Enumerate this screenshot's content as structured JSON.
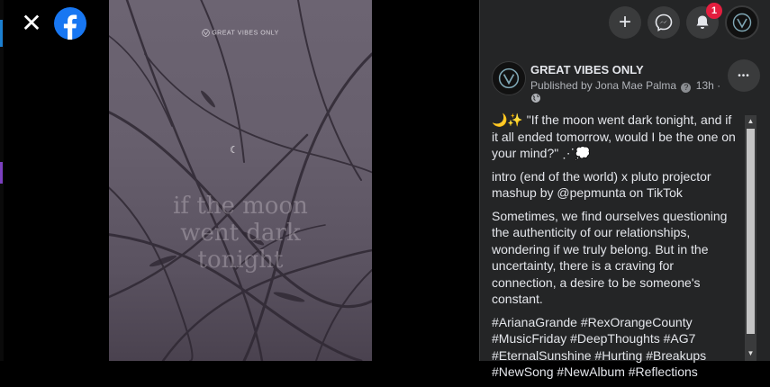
{
  "close_glyph": "✕",
  "media": {
    "watermark": "GREAT VIBES ONLY",
    "overlay_lines": [
      "if the moon",
      "went dark",
      "tonight"
    ]
  },
  "topbar": {
    "plus_glyph": "+",
    "notification_count": "1"
  },
  "post": {
    "page_name": "GREAT VIBES ONLY",
    "published_prefix": "Published by Jona Mae Palma",
    "time": "13h ·",
    "more_glyph": "•••",
    "paragraphs": [
      "🌙✨ \"If the moon went dark tonight, and if it all ended tomorrow, would I be the one on your mind?\" ⋰💭",
      "intro (end of the world) x pluto projector mashup by @pepmunta on TikTok",
      "Sometimes, we find ourselves questioning the authenticity of our relationships, wondering if we truly belong. But in the uncertainty, there is a craving for connection, a desire to be someone's constant.",
      "#ArianaGrande #RexOrangeCounty #MusicFriday #DeepThoughts #AG7 #EternalSunshine #Hurting #Breakups #NewSong #NewAlbum #Reflections"
    ]
  },
  "scrollbar": {
    "up": "▲",
    "down": "▼"
  },
  "colors": {
    "panel_bg": "#242526",
    "text": "#e4e6eb",
    "muted": "#b0b3b8",
    "brand": "#1877f2",
    "badge": "#e41e3f"
  },
  "icons": [
    "close-icon",
    "facebook-logo-icon",
    "plus-icon",
    "messenger-icon",
    "bell-icon",
    "globe-icon",
    "info-icon",
    "more-icon"
  ]
}
